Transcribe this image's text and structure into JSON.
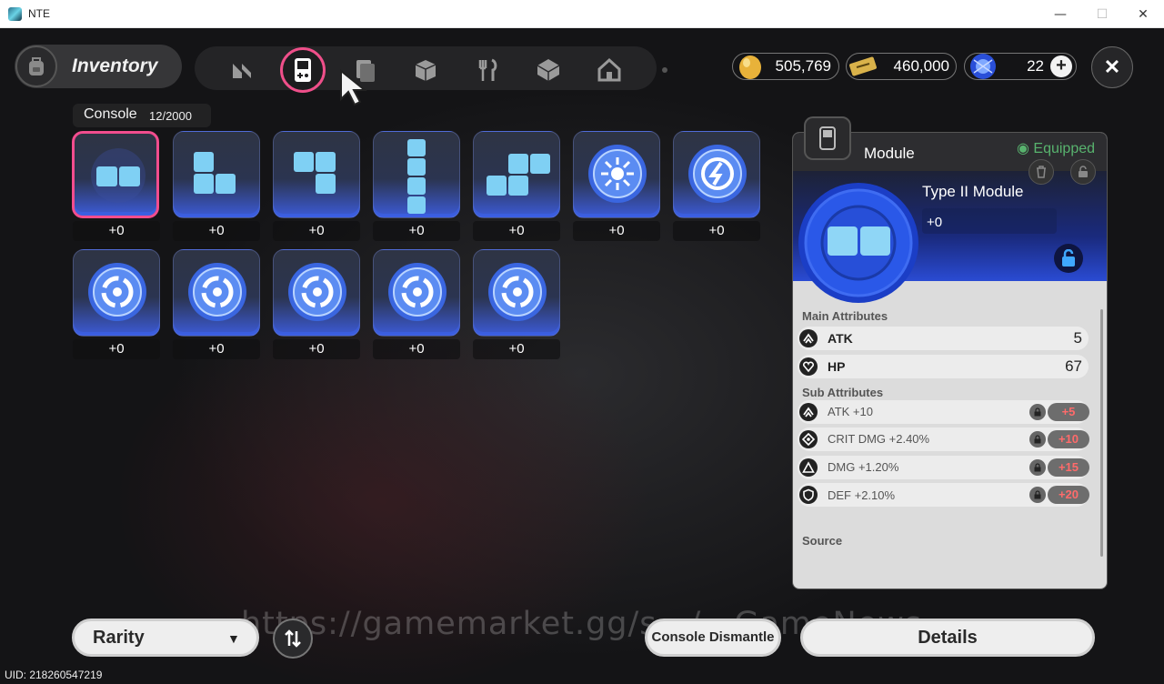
{
  "window": {
    "title": "NTE",
    "minimize": "—",
    "maximize": "☐",
    "close": "✕"
  },
  "header": {
    "title": "Inventory",
    "tabs": [
      {
        "name": "tab-nte",
        "active": false
      },
      {
        "name": "tab-console",
        "active": true
      },
      {
        "name": "tab-cards",
        "active": false
      },
      {
        "name": "tab-box",
        "active": false
      },
      {
        "name": "tab-food",
        "active": false
      },
      {
        "name": "tab-gift",
        "active": false
      },
      {
        "name": "tab-home",
        "active": false
      }
    ],
    "currencies": [
      {
        "icon": "gold-egg-icon",
        "value": "505,769"
      },
      {
        "icon": "ticket-icon",
        "value": "460,000"
      },
      {
        "icon": "crystal-icon",
        "value": "22"
      }
    ],
    "plus": "+",
    "close": "✕"
  },
  "console": {
    "label": "Console",
    "count": "12/2000"
  },
  "items": [
    {
      "shape": "tile-2h",
      "level": "+0",
      "selected": true
    },
    {
      "shape": "tile-L",
      "level": "+0"
    },
    {
      "shape": "tile-J",
      "level": "+0"
    },
    {
      "shape": "tile-I",
      "level": "+0"
    },
    {
      "shape": "tile-S",
      "level": "+0"
    },
    {
      "shape": "coin-star",
      "level": "+0"
    },
    {
      "shape": "coin-bolt",
      "level": "+0"
    },
    {
      "shape": "coin-spin",
      "level": "+0"
    },
    {
      "shape": "coin-spin",
      "level": "+0"
    },
    {
      "shape": "coin-spin",
      "level": "+0"
    },
    {
      "shape": "coin-spin",
      "level": "+0"
    },
    {
      "shape": "coin-spin",
      "level": "+0"
    }
  ],
  "panel": {
    "title": "Module",
    "status": "Equipped",
    "name": "Type II Module",
    "level": "+0",
    "main_title": "Main Attributes",
    "main": [
      {
        "name": "ATK",
        "value": "5",
        "icon": "atk-icon"
      },
      {
        "name": "HP",
        "value": "67",
        "icon": "hp-icon"
      }
    ],
    "sub_title": "Sub Attributes",
    "sub": [
      {
        "name": "ATK +10",
        "roll": "+5",
        "icon": "atk-icon"
      },
      {
        "name": "CRIT DMG +2.40%",
        "roll": "+10",
        "icon": "crit-icon"
      },
      {
        "name": "DMG +1.20%",
        "roll": "+15",
        "icon": "dmg-icon"
      },
      {
        "name": "DEF +2.10%",
        "roll": "+20",
        "icon": "def-icon"
      }
    ],
    "source_title": "Source"
  },
  "footer": {
    "rarity": "Rarity",
    "caret": "▼",
    "dismantle": "Console Dismantle",
    "details": "Details",
    "watermark": "https://gamemarket.gg/s…/…GameNews",
    "uid": "UID: 218260547219"
  },
  "colors": {
    "accent_pink": "#ef4f8a",
    "equipped_green": "#58b36e",
    "roll_red": "#ff6b6b",
    "item_blue": "#3c5bd8"
  }
}
